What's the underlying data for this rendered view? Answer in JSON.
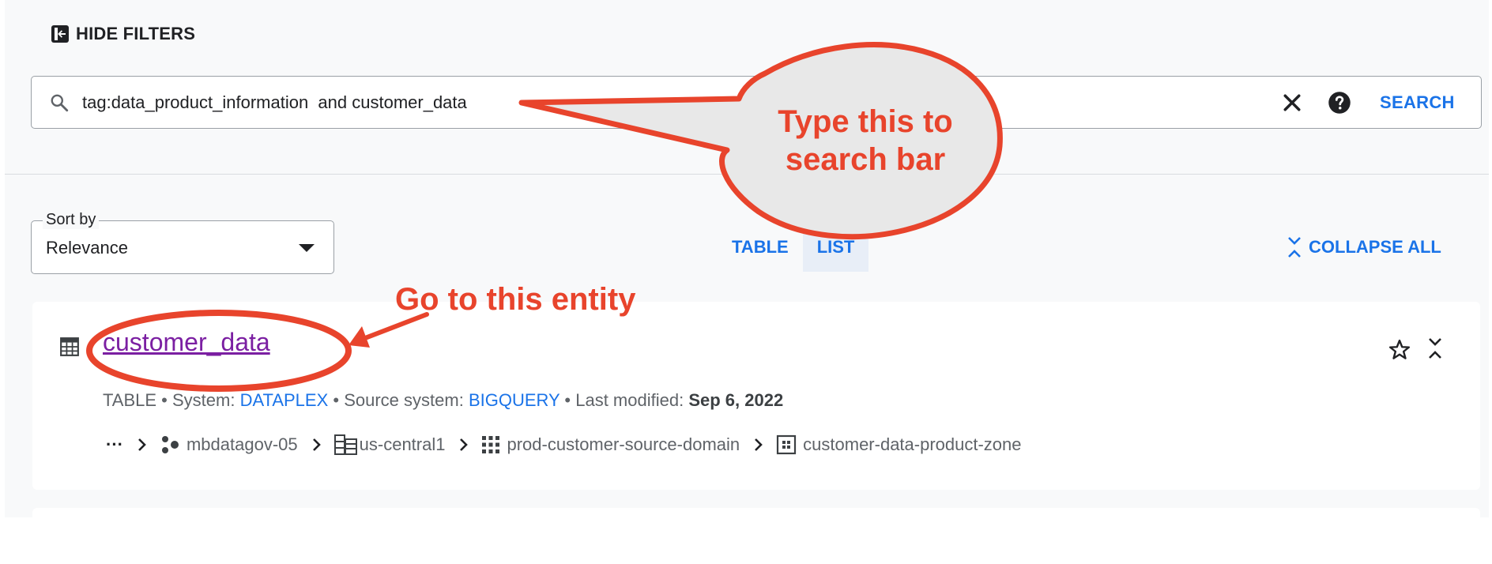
{
  "filters": {
    "hide_label": "HIDE FILTERS"
  },
  "search": {
    "query": "tag:data_product_information  and customer_data",
    "button_label": "SEARCH"
  },
  "sort": {
    "legend": "Sort by",
    "value": "Relevance"
  },
  "view_tabs": [
    {
      "label": "TABLE",
      "active": false
    },
    {
      "label": "LIST",
      "active": true
    }
  ],
  "collapse_label": "COLLAPSE ALL",
  "result": {
    "name": "customer_data",
    "type": "TABLE",
    "system_label": "System:",
    "system_value": "DATAPLEX",
    "source_label": "Source system:",
    "source_value": "BIGQUERY",
    "modified_label": "Last modified:",
    "modified_value": "Sep 6, 2022",
    "path": {
      "more": "···",
      "project": "mbdatagov-05",
      "location": "us-central1",
      "lake": "prod-customer-source-domain",
      "zone": "customer-data-product-zone"
    }
  },
  "annotations": {
    "callout": "Type this to search bar",
    "entity_hint": "Go to this entity"
  },
  "colors": {
    "accent": "#1a73e8",
    "link": "#7b1fa2",
    "annotation": "#e8442c"
  }
}
